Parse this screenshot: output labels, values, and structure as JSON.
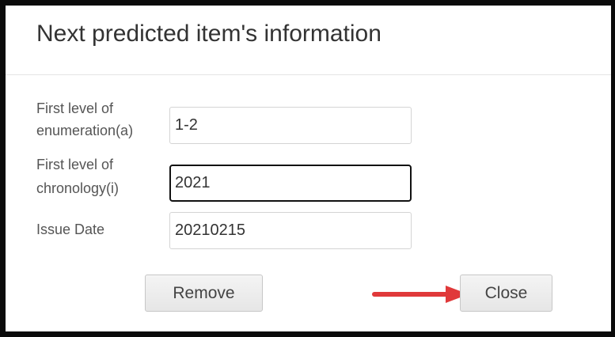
{
  "dialog": {
    "title": "Next predicted item's information"
  },
  "form": {
    "enumeration_label_line1": "First level of",
    "enumeration_label_line2": "enumeration(a)",
    "enumeration_value": "1-2",
    "chronology_label_line1": "First level of",
    "chronology_label_line2": "chronology(i)",
    "chronology_value": "2021",
    "issue_date_label": "Issue Date",
    "issue_date_value": "20210215"
  },
  "footer": {
    "remove_label": "Remove",
    "close_label": "Close"
  },
  "annotation": {
    "arrow_color": "#e0393a",
    "arrow_icon": "red-arrow-pointing-right"
  }
}
